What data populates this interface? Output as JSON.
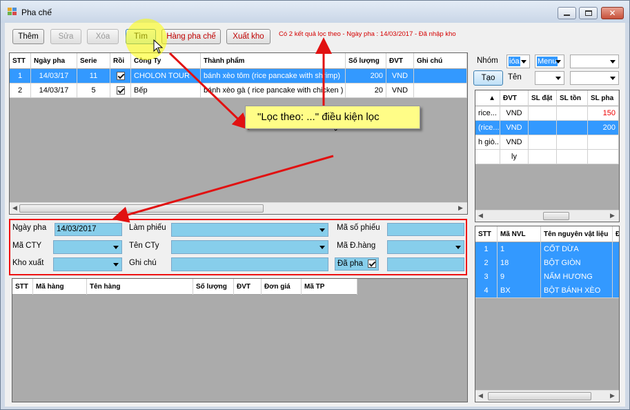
{
  "window": {
    "title": "Pha chế"
  },
  "toolbar": {
    "add_label": "Thêm",
    "edit_label": "Sửa",
    "delete_label": "Xóa",
    "find_label": "Tìm",
    "products_label": "Hàng pha chế",
    "export_label": "Xuất kho",
    "status_text": "Có 2 kết quả lọc theo  - Ngày pha : 14/03/2017 - Đã nhập kho"
  },
  "main_grid": {
    "columns": [
      "STT",
      "Ngày pha",
      "Serie",
      "Rồi",
      "Công Ty",
      "Thành phẩm",
      "Số lượng",
      "ĐVT",
      "Ghi chú"
    ],
    "rows": [
      {
        "stt": "1",
        "date": "14/03/17",
        "serie": "11",
        "done": true,
        "company": "CHOLON TOUR",
        "product": "bánh xèo tôm (rice pancake with shrimp)",
        "qty": "200",
        "unit": "VND",
        "note": ""
      },
      {
        "stt": "2",
        "date": "14/03/17",
        "serie": "5",
        "done": true,
        "company": "Bếp",
        "product": "bánh xèo gà ( rice pancake with chicken )",
        "qty": "20",
        "unit": "VND",
        "note": ""
      }
    ]
  },
  "callout": {
    "text": "\"Lọc theo: ...\" điều kiện lọc"
  },
  "filter_form": {
    "date_label": "Ngày pha",
    "date_value": "14/03/2017",
    "maker_label": "Làm phiếu",
    "ticket_label": "Mã số phiếu",
    "company_code_label": "Mã CTY",
    "company_name_label": "Tên CTy",
    "order_code_label": "Mã Đ.hàng",
    "warehouse_label": "Kho xuất",
    "note_label": "Ghi chú",
    "mixed_label": "Đã pha",
    "mixed_checked": true
  },
  "detail_grid": {
    "columns": [
      "STT",
      "Mã hàng",
      "Tên hàng",
      "Số lượng",
      "ĐVT",
      "Đơn giá",
      "Mã TP"
    ]
  },
  "right_panel": {
    "group_label": "Nhóm",
    "group_value": "ióa",
    "menu_value": "Menu",
    "create_label": "Tạo",
    "name_label": "Tên",
    "upper_grid": {
      "columns": [
        "",
        "ĐVT",
        "SL đặt",
        "SL tồn",
        "SL pha"
      ],
      "rows": [
        {
          "name": "rice...",
          "unit": "VND",
          "ordered": "",
          "stock": "",
          "mix": "150",
          "sel": false,
          "red": true
        },
        {
          "name": "(rice...",
          "unit": "VND",
          "ordered": "",
          "stock": "",
          "mix": "200",
          "sel": true,
          "red": false
        },
        {
          "name": "h giò...",
          "unit": "VND",
          "ordered": "",
          "stock": "",
          "mix": "",
          "sel": false,
          "red": false
        },
        {
          "name": "",
          "unit": "ly",
          "ordered": "",
          "stock": "",
          "mix": "",
          "sel": false,
          "red": false
        }
      ]
    },
    "material_grid": {
      "columns": [
        "STT",
        "Mã NVL",
        "Tên nguyên vật liệu",
        "Đ"
      ],
      "rows": [
        {
          "stt": "1",
          "code": "1",
          "name": "CỐT DỪA"
        },
        {
          "stt": "2",
          "code": "18",
          "name": "BỘT GIÒN"
        },
        {
          "stt": "3",
          "code": "9",
          "name": "NẤM HƯƠNG"
        },
        {
          "stt": "4",
          "code": "BX",
          "name": "BỘT BÁNH XÈO"
        }
      ]
    }
  },
  "colors": {
    "selection": "#3399ff",
    "field": "#87ceeb",
    "highlight_red": "#e11111",
    "callout_bg": "#fffd87"
  }
}
